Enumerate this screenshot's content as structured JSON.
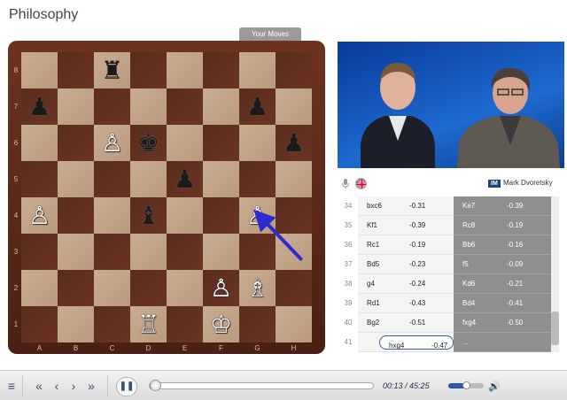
{
  "title": "Philosophy",
  "your_moves_label": "Your Moves",
  "board": {
    "ranks": [
      "8",
      "7",
      "6",
      "5",
      "4",
      "3",
      "2",
      "1"
    ],
    "files": [
      "A",
      "B",
      "C",
      "D",
      "E",
      "F",
      "G",
      "H"
    ],
    "pieces": [
      {
        "square": "c8",
        "glyph": "♜",
        "color": "black",
        "name": "black-rook"
      },
      {
        "square": "a7",
        "glyph": "♟",
        "color": "black",
        "name": "black-pawn"
      },
      {
        "square": "g7",
        "glyph": "♟",
        "color": "black",
        "name": "black-pawn"
      },
      {
        "square": "c6",
        "glyph": "♙",
        "color": "white",
        "name": "white-pawn"
      },
      {
        "square": "d6",
        "glyph": "♚",
        "color": "black",
        "name": "black-king"
      },
      {
        "square": "h6",
        "glyph": "♟",
        "color": "black",
        "name": "black-pawn"
      },
      {
        "square": "e5",
        "glyph": "♟",
        "color": "black",
        "name": "black-pawn"
      },
      {
        "square": "a4",
        "glyph": "♙",
        "color": "white",
        "name": "white-pawn"
      },
      {
        "square": "d4",
        "glyph": "♝",
        "color": "black",
        "name": "black-bishop"
      },
      {
        "square": "g4",
        "glyph": "♙",
        "color": "white",
        "name": "white-pawn"
      },
      {
        "square": "f2",
        "glyph": "♙",
        "color": "white",
        "name": "white-pawn"
      },
      {
        "square": "g2",
        "glyph": "♗",
        "color": "white",
        "name": "white-bishop"
      },
      {
        "square": "d1",
        "glyph": "♖",
        "color": "white",
        "name": "white-rook"
      },
      {
        "square": "f1",
        "glyph": "♔",
        "color": "white",
        "name": "white-king"
      }
    ],
    "arrow": {
      "from": "h3",
      "to": "g4",
      "color": "#2b2bd0"
    }
  },
  "video": {
    "commentator_title": "IM",
    "commentator_name": "Mark Dvoretsky",
    "icons": [
      "microphone-icon",
      "uk-flag-icon"
    ]
  },
  "moves": [
    {
      "num": "34",
      "white": "bxc6",
      "white_eval": "-0.31",
      "black": "Ke7",
      "black_eval": "-0.39"
    },
    {
      "num": "35",
      "white": "Kf1",
      "white_eval": "-0.39",
      "black": "Rc8",
      "black_eval": "-0.19"
    },
    {
      "num": "36",
      "white": "Rc1",
      "white_eval": "-0.19",
      "black": "Bb6",
      "black_eval": "-0.16"
    },
    {
      "num": "37",
      "white": "Bd5",
      "white_eval": "-0.23",
      "black": "f5",
      "black_eval": "-0.09"
    },
    {
      "num": "38",
      "white": "g4",
      "white_eval": "-0.24",
      "black": "Kd6",
      "black_eval": "-0.21"
    },
    {
      "num": "39",
      "white": "Rd1",
      "white_eval": "-0.43",
      "black": "Bd4",
      "black_eval": "-0.41"
    },
    {
      "num": "40",
      "white": "Bg2",
      "white_eval": "-0.51",
      "black": "fxg4",
      "black_eval": "-0.50"
    },
    {
      "num": "41",
      "white": "hxg4",
      "white_eval": "-0.47",
      "black": "...",
      "black_eval": ""
    }
  ],
  "player": {
    "current_time": "00:13",
    "total_time": "45:25",
    "time_sep": " / ",
    "progress_fraction": 0.005,
    "volume_fraction": 0.55,
    "accent_color": "#3c64a8"
  }
}
